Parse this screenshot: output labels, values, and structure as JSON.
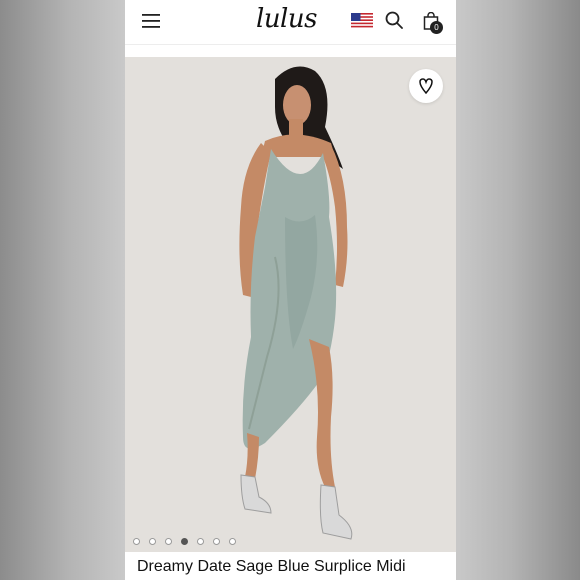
{
  "header": {
    "logo_text": "lulus",
    "menu_icon": "hamburger-menu-icon",
    "region_icon": "us-flag-icon",
    "search_icon": "search-icon",
    "bag_icon": "shopping-bag-icon",
    "bag_count": "0"
  },
  "gallery": {
    "wishlist_icon": "heart-icon",
    "image_alt": "Model wearing sage blue satin surplice midi dress with silver platform heels",
    "dots": [
      "1",
      "2",
      "3",
      "4",
      "5",
      "6",
      "7"
    ],
    "active_dot": 4
  },
  "product": {
    "title": "Dreamy Date Sage Blue Surplice Midi"
  },
  "colors": {
    "dress": "#9fb1ab",
    "backdrop": "#e3e0dc",
    "skin": "#c48a66"
  }
}
